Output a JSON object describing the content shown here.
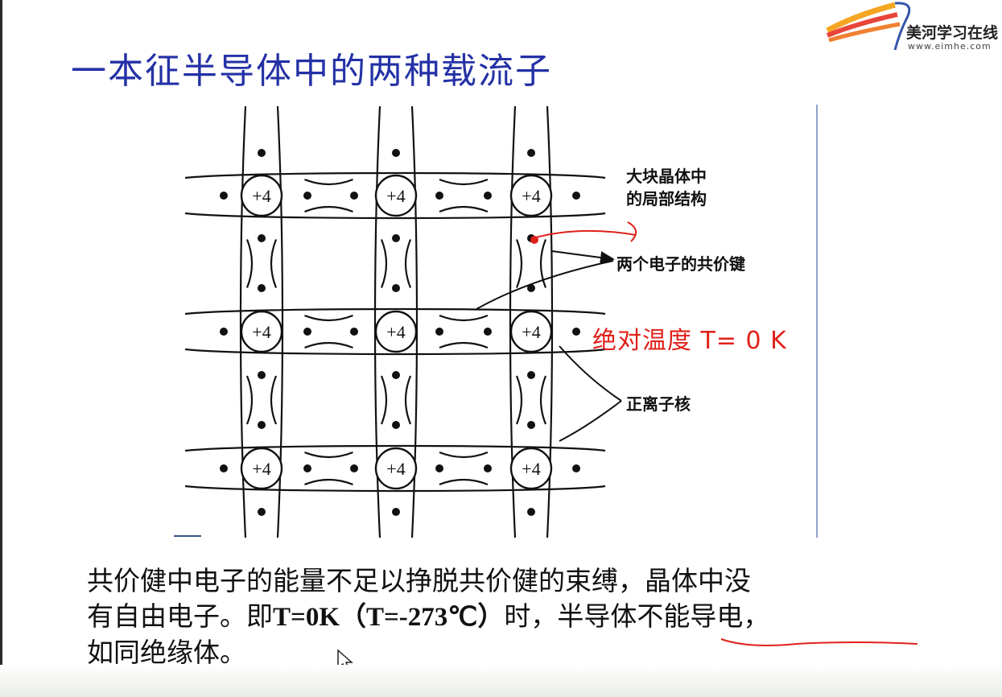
{
  "logo": {
    "name": "美河学习在线",
    "url": "www.eimhe.com",
    "colors": [
      "#e8453a",
      "#f5a623",
      "#3355a8"
    ]
  },
  "title": "一本征半导体中的两种载流子",
  "diagram": {
    "nucleus_label": "+4",
    "lattice_rows": 3,
    "lattice_cols": 3,
    "captions": {
      "structure_line1": "大块晶体中",
      "structure_line2": "的局部结构",
      "bond": "两个电子的共价键",
      "ion": "正离子核"
    },
    "annotation": "绝对温度 T= 0 K"
  },
  "body": {
    "line1": "共价健中电子的能量不足以挣脱共价健的束缚，晶体中没",
    "line2_a": "有自由电子。即",
    "line2_b": "T=0K（T=-273℃）",
    "line2_c": "时，",
    "line2_d": "半导体不能导电",
    "line2_e": "，",
    "line3": "如同绝缘体。"
  },
  "colors": {
    "title": "#2431a6",
    "annotation": "#e0201a",
    "text": "#111111"
  }
}
